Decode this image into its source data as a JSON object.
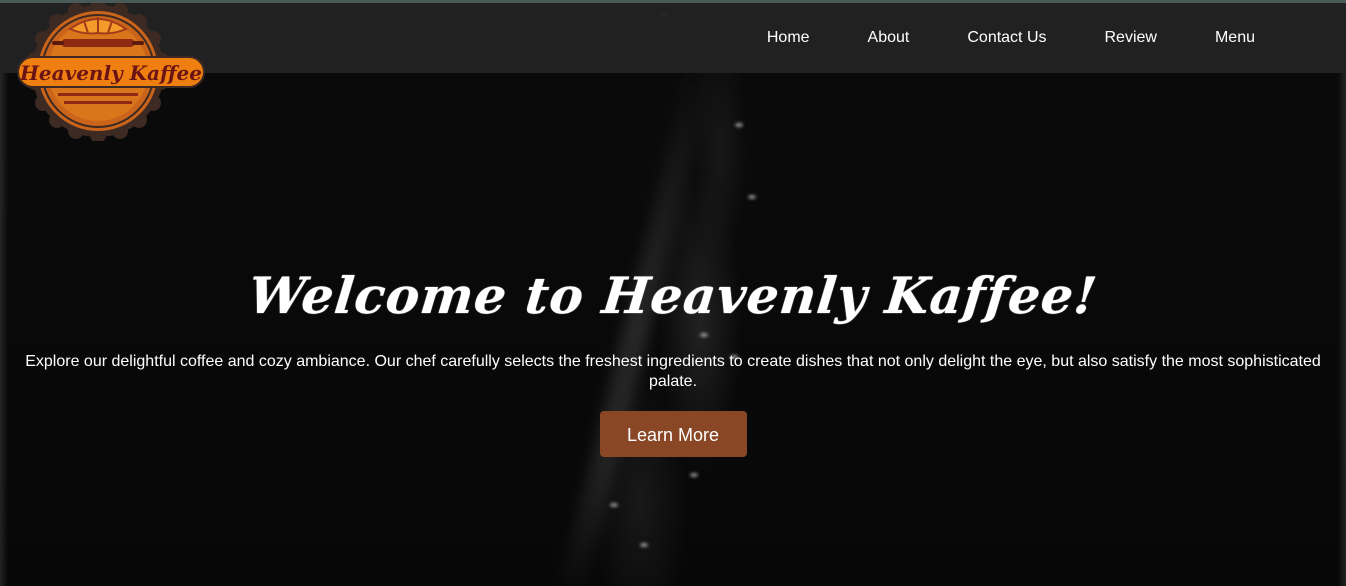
{
  "brand": {
    "logo_text": "Heavenly Kaffee",
    "colors": {
      "badge_outer": "#3d2a22",
      "badge_orange": "#d9751b",
      "banner_orange": "#f07f12",
      "banner_text": "#6b1414"
    }
  },
  "nav": {
    "items": [
      {
        "label": "Home"
      },
      {
        "label": "About"
      },
      {
        "label": "Contact Us"
      },
      {
        "label": "Review"
      },
      {
        "label": "Menu"
      }
    ]
  },
  "hero": {
    "title": "Welcome to Heavenly Kaffee!",
    "description": "Explore our delightful coffee and cozy ambiance. Our chef carefully selects the freshest ingredients to create dishes that not only delight the eye, but also satisfy the most sophisticated palate.",
    "button_label": "Learn More",
    "button_color": "#8a4726"
  }
}
